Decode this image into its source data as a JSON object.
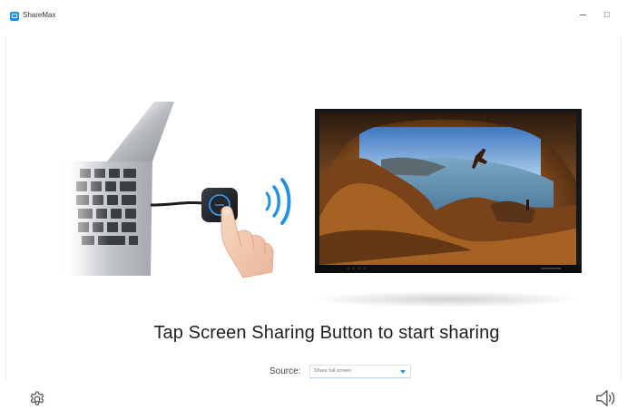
{
  "app": {
    "title": "ShareMax",
    "logo_icon": "sharemax-logo-icon"
  },
  "window_controls": {
    "minimize_icon": "minimize-icon",
    "maximize_icon": "maximize-icon"
  },
  "main": {
    "headline": "Tap Screen Sharing Button to start sharing",
    "source": {
      "label": "Source:",
      "selected": "Share full screen"
    }
  },
  "footer": {
    "settings_icon": "gear-icon",
    "audio_icon": "speaker-icon"
  },
  "colors": {
    "accent": "#2a93e8",
    "text": "#1f1f1f",
    "background": "#ffffff"
  }
}
